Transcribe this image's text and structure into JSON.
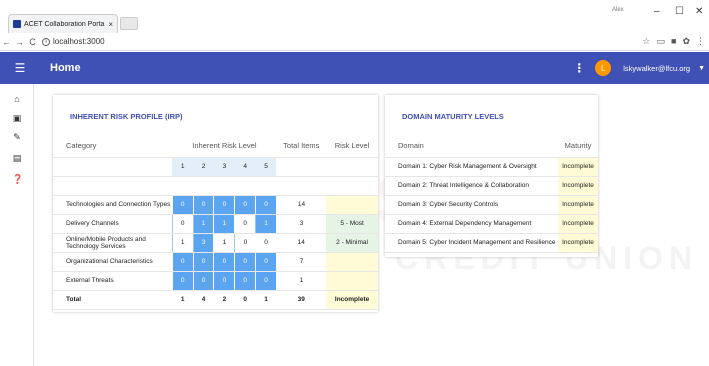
{
  "browser": {
    "tab_title": "ACET Collaboration Porta",
    "tab_close": "×",
    "url": "localhost:3000",
    "profile_label": "Alex",
    "win_min": "–",
    "win_max": "☐",
    "win_close": "✕"
  },
  "appbar": {
    "title": "Home",
    "avatar_letter": "L",
    "username": "lskywalker@lfcu.org",
    "color": "#3f51b5"
  },
  "watermark": {
    "line1": "SE",
    "line2": "CREDIT UNION"
  },
  "irp": {
    "title": "INHERENT RISK PROFILE (IRP)",
    "headers": {
      "category": "Category",
      "inherent": "Inherent Risk Level",
      "total": "Total Items",
      "risk": "Risk Level"
    },
    "levels": [
      "1",
      "2",
      "3",
      "4",
      "5"
    ],
    "rows": [
      {
        "category": "Technologies and Connection Types",
        "levels": [
          "0",
          "0",
          "0",
          "0",
          "0"
        ],
        "total": "14",
        "risk": ""
      },
      {
        "category": "Delivery Channels",
        "levels": [
          "0",
          "1",
          "1",
          "0",
          "1"
        ],
        "total": "3",
        "risk": "5 - Most"
      },
      {
        "category": "Online/Mobile Products and Technology Services",
        "levels": [
          "1",
          "3",
          "1",
          "0",
          "0"
        ],
        "total": "14",
        "risk": "2 - Minimal"
      },
      {
        "category": "Organizational Characteristics",
        "levels": [
          "0",
          "0",
          "0",
          "0",
          "0"
        ],
        "total": "7",
        "risk": ""
      },
      {
        "category": "External Threats",
        "levels": [
          "0",
          "0",
          "0",
          "0",
          "0"
        ],
        "total": "1",
        "risk": ""
      }
    ],
    "total": {
      "label": "Total",
      "levels": [
        "1",
        "4",
        "2",
        "0",
        "1"
      ],
      "total": "39",
      "risk": "Incomplete"
    }
  },
  "dm": {
    "title": "DOMAIN MATURITY LEVELS",
    "headers": {
      "domain": "Domain",
      "maturity": "Maturity"
    },
    "rows": [
      {
        "domain": "Domain 1: Cyber Risk Management & Oversight",
        "maturity": "Incomplete"
      },
      {
        "domain": "Domain 2: Threat Intelligence & Collaboration",
        "maturity": "Incomplete"
      },
      {
        "domain": "Domain 3: Cyber Security Controls",
        "maturity": "Incomplete"
      },
      {
        "domain": "Domain 4: External Dependency Management",
        "maturity": "Incomplete"
      },
      {
        "domain": "Domain 5: Cyber Incident Management and Resilience",
        "maturity": "Incomplete"
      }
    ]
  }
}
